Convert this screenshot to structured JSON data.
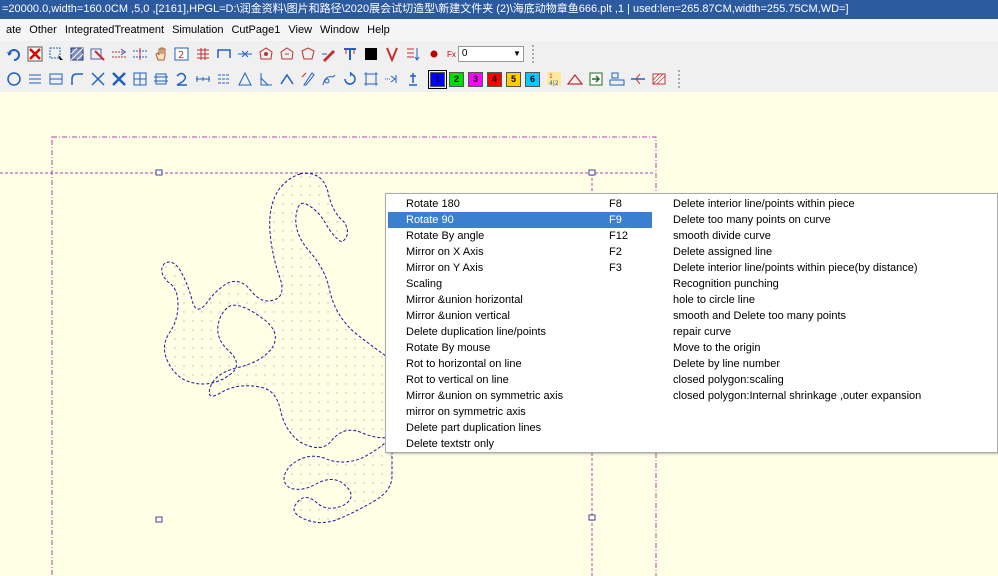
{
  "window": {
    "title": "=20000.0,width=160.0CM ,5,0 ,[2161],HPGL=D:\\润金资料\\图片和路径\\2020展会试切造型\\新建文件夹 (2)\\海底动物章鱼666.plt ,1 | used:len=265.87CM,width=255.75CM,WD=]"
  },
  "menubar": {
    "items": [
      "ate",
      "Other",
      "IntegratedTreatment",
      "Simulation",
      "CutPage1",
      "View",
      "Window",
      "Help"
    ]
  },
  "toolbar1": {
    "icons": [
      "undo-icon",
      "delete-icon",
      "select-rect-icon",
      "hatch-icon",
      "pattern-icon",
      "move-points-icon",
      "align-icon",
      "hand-icon",
      "node-number-icon",
      "table-icon",
      "rect-open-icon",
      "arrow-join-icon",
      "shape-a-icon",
      "shape-b-icon",
      "shape-c-icon",
      "pen-icon",
      "knife-icon",
      "black-square-icon",
      "v-icon",
      "sort-icon",
      "dot-icon"
    ],
    "combo": {
      "label": "Fx",
      "value": "0"
    }
  },
  "toolbar2": {
    "icons": [
      "circle-icon",
      "parallel-lines-icon",
      "box-icon",
      "corner-icon",
      "cross-x-icon",
      "cross-xx-icon",
      "grid-a-icon",
      "grid-b-icon",
      "curve-2-icon",
      "measure-icon",
      "measure-b-icon",
      "triangle-icon",
      "angle-icon",
      "caret-icon",
      "clip-icon",
      "mirror-icon",
      "rotate-icon",
      "frame-icon",
      "dots-icon",
      "stand-icon"
    ],
    "numbers": [
      {
        "label": "1",
        "color": "#0000ff"
      },
      {
        "label": "2",
        "color": "#00dd00"
      },
      {
        "label": "3",
        "color": "#ff00ff"
      },
      {
        "label": "4",
        "color": "#ff0000"
      },
      {
        "label": "5",
        "color": "#ffcc00"
      },
      {
        "label": "6",
        "color": "#00ccff"
      }
    ],
    "icons_after": [
      "fraction-icon",
      "tent-icon",
      "import-icon",
      "layout-icon",
      "knife-line-icon",
      "hatch-box-icon"
    ]
  },
  "context_menu": {
    "left_items": [
      {
        "label": "Rotate 180",
        "shortcut": "F8"
      },
      {
        "label": "Rotate 90",
        "shortcut": "F9"
      },
      {
        "label": "Rotate By angle",
        "shortcut": "F12"
      },
      {
        "label": "Mirror on X Axis",
        "shortcut": "F2"
      },
      {
        "label": "Mirror on Y Axis",
        "shortcut": "F3"
      },
      {
        "label": "Scaling",
        "shortcut": ""
      },
      {
        "label": "Mirror &union horizontal",
        "shortcut": ""
      },
      {
        "label": "Mirror &union vertical",
        "shortcut": ""
      },
      {
        "label": "Delete duplication line/points",
        "shortcut": ""
      },
      {
        "label": "Rotate By mouse",
        "shortcut": ""
      },
      {
        "label": "Rot to horizontal on line",
        "shortcut": ""
      },
      {
        "label": "Rot to vertical on line",
        "shortcut": ""
      },
      {
        "label": "Mirror &union on symmetric axis",
        "shortcut": ""
      },
      {
        "label": "mirror on symmetric axis",
        "shortcut": ""
      },
      {
        "label": "Delete part duplication lines",
        "shortcut": ""
      },
      {
        "label": "Delete textstr only",
        "shortcut": ""
      }
    ],
    "highlighted_item": "Rotate 90",
    "right_items": [
      "Delete interior line/points within piece",
      "Delete too many points on curve",
      "smooth divide curve",
      "Delete assigned line",
      "Delete interior line/points within piece(by distance)",
      "Recognition punching",
      "hole to circle line",
      "smooth and Delete too many points",
      "repair curve",
      "Move to the origin",
      "Delete by line number",
      "closed polygon:scaling",
      "closed polygon:Internal shrinkage ,outer expansion"
    ]
  },
  "colors": {
    "titlebar": "#2c5aa0",
    "workspace": "#ffffe6",
    "highlight": "#3b7fd0",
    "boundary_dash": "#b040b0",
    "handle": "#4040a0"
  }
}
